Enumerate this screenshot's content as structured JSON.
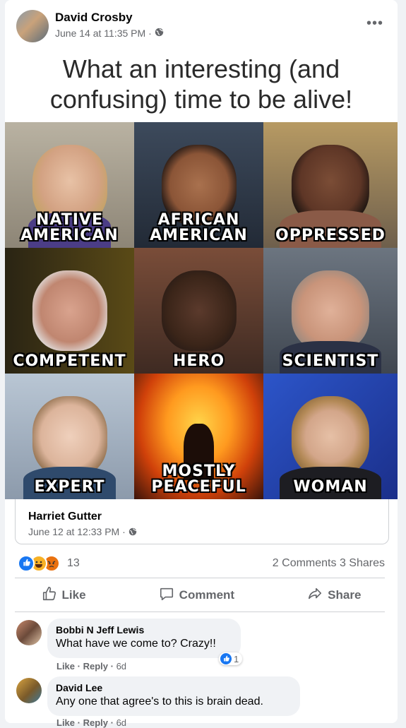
{
  "post": {
    "author": "David Crosby",
    "timestamp": "June 14 at 11:35 PM",
    "separator": "·",
    "more_label": "•••"
  },
  "meme": {
    "title_line1": "What an interesting (and",
    "title_line2": "confusing) time to be alive!",
    "tiles": [
      {
        "caption_lines": [
          "NATIVE",
          "AMERICAN"
        ]
      },
      {
        "caption_lines": [
          "AFRICAN",
          "AMERICAN"
        ]
      },
      {
        "caption_lines": [
          "OPPRESSED"
        ]
      },
      {
        "caption_lines": [
          "COMPETENT"
        ]
      },
      {
        "caption_lines": [
          "HERO"
        ]
      },
      {
        "caption_lines": [
          "SCIENTIST"
        ]
      },
      {
        "caption_lines": [
          "EXPERT"
        ]
      },
      {
        "caption_lines": [
          "MOSTLY",
          "PEACEFUL"
        ]
      },
      {
        "caption_lines": [
          "WOMAN"
        ]
      }
    ]
  },
  "shared_from": {
    "author": "Harriet Gutter",
    "timestamp": "June 12 at 12:33 PM",
    "separator": "·"
  },
  "stats": {
    "reaction_count": "13",
    "comments": "2 Comments",
    "shares": "3 Shares",
    "reaction_icons": [
      "like-icon",
      "haha-icon",
      "angry-icon"
    ]
  },
  "actions": {
    "like": "Like",
    "comment": "Comment",
    "share": "Share"
  },
  "comments": [
    {
      "name": "Bobbi N Jeff Lewis",
      "text": "What have we come to? Crazy!!",
      "like_label": "Like",
      "reply_label": "Reply",
      "age": "6d",
      "like_count": "1"
    },
    {
      "name": "David Lee",
      "text": "Any one that agree's to this is brain dead.",
      "like_label": "Like",
      "reply_label": "Reply",
      "age": "6d"
    }
  ],
  "colors": {
    "facebook_blue": "#1877f2",
    "secondary_text": "#65676b",
    "haha_yellow": "#f7b125",
    "angry_red": "#e9710f"
  }
}
